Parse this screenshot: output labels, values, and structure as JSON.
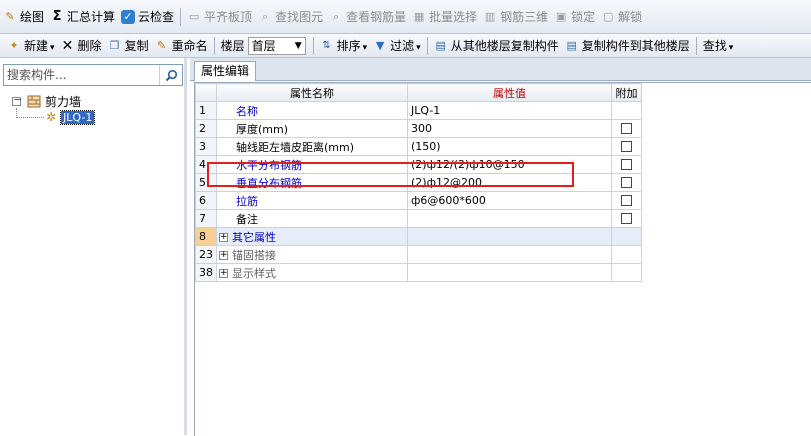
{
  "toolbar_top": {
    "items": [
      {
        "label": "绘图",
        "icon": "draw-icon",
        "enabled": true
      },
      {
        "label": "汇总计算",
        "icon": "sigma-icon",
        "enabled": true
      },
      {
        "label": "云检查",
        "icon": "cloud-check-icon",
        "enabled": true
      },
      {
        "label": "平齐板顶",
        "icon": "align-slab-icon",
        "enabled": false
      },
      {
        "label": "查找图元",
        "icon": "find-element-icon",
        "enabled": false
      },
      {
        "label": "查看钢筋量",
        "icon": "view-rebar-icon",
        "enabled": false
      },
      {
        "label": "批量选择",
        "icon": "batch-select-icon",
        "enabled": false
      },
      {
        "label": "钢筋三维",
        "icon": "rebar-3d-icon",
        "enabled": false
      },
      {
        "label": "锁定",
        "icon": "lock-icon",
        "enabled": false
      },
      {
        "label": "解锁",
        "icon": "unlock-icon",
        "enabled": false
      }
    ]
  },
  "toolbar_second": {
    "new_label": "新建",
    "delete_label": "删除",
    "copy_label": "复制",
    "rename_label": "重命名",
    "floor_label": "楼层",
    "floor_value": "首层",
    "sort_label": "排序",
    "filter_label": "过滤",
    "copy_from_floor_label": "从其他楼层复制构件",
    "copy_to_floor_label": "复制构件到其他楼层",
    "find_label": "查找"
  },
  "left_panel": {
    "search_placeholder": "搜索构件...",
    "tree": {
      "group_label": "剪力墙",
      "expander": "－",
      "items": [
        {
          "label": "JLQ-1",
          "selected": true
        }
      ]
    }
  },
  "property_editor": {
    "tab_label": "属性编辑",
    "columns": {
      "name": "属性名称",
      "value": "属性值",
      "extra": "附加"
    },
    "rows": [
      {
        "num": "1",
        "name": "名称",
        "value": "JLQ-1",
        "name_style": "blue",
        "checkbox": false,
        "expandable": false,
        "selected": false
      },
      {
        "num": "2",
        "name": "厚度(mm)",
        "value": "300",
        "name_style": "black",
        "checkbox": true,
        "expandable": false,
        "selected": false
      },
      {
        "num": "3",
        "name": "轴线距左墙皮距离(mm)",
        "value": "(150)",
        "name_style": "black",
        "checkbox": true,
        "expandable": false,
        "selected": false
      },
      {
        "num": "4",
        "name": "水平分布钢筋",
        "value": "(2)ф12/(2)ф10@150",
        "name_style": "blue",
        "checkbox": true,
        "expandable": false,
        "selected": false
      },
      {
        "num": "5",
        "name": "垂直分布钢筋",
        "value": "(2)ф12@200",
        "name_style": "blue",
        "checkbox": true,
        "expandable": false,
        "selected": false
      },
      {
        "num": "6",
        "name": "拉筋",
        "value": "ф6@600*600",
        "name_style": "blue",
        "checkbox": true,
        "expandable": false,
        "selected": false
      },
      {
        "num": "7",
        "name": "备注",
        "value": "",
        "name_style": "black",
        "checkbox": true,
        "expandable": false,
        "selected": false
      },
      {
        "num": "8",
        "name": "其它属性",
        "value": "",
        "name_style": "blue",
        "checkbox": false,
        "expandable": true,
        "selected": true
      },
      {
        "num": "23",
        "name": "锚固搭接",
        "value": "",
        "name_style": "gray",
        "checkbox": false,
        "expandable": true,
        "selected": false
      },
      {
        "num": "38",
        "name": "显示样式",
        "value": "",
        "name_style": "gray",
        "checkbox": false,
        "expandable": true,
        "selected": false
      }
    ]
  },
  "colors": {
    "accent_red": "#e02020",
    "link_blue": "#0000c8",
    "selected_row_num": "#f7cf92"
  }
}
